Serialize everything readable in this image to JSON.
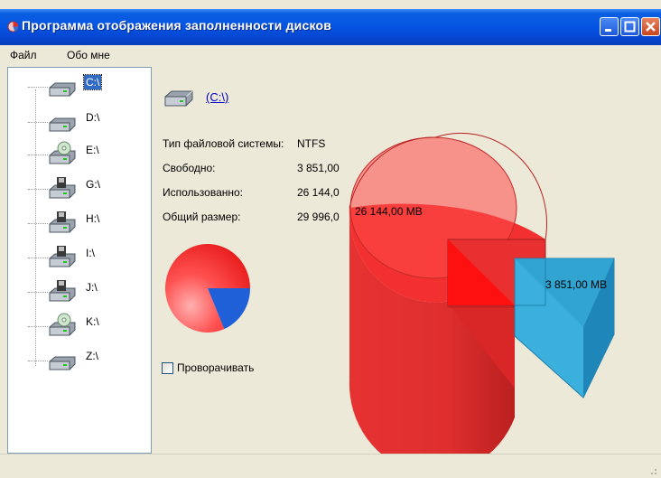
{
  "window": {
    "title": "Программа отображения заполненности дисков"
  },
  "menu": [
    {
      "label": "Файл"
    },
    {
      "label": "Обо мне"
    }
  ],
  "tree": {
    "items": [
      {
        "label": "C:\\",
        "icon": "hard-drive-icon",
        "selected": true
      },
      {
        "label": "D:\\",
        "icon": "hard-drive-icon"
      },
      {
        "label": "E:\\",
        "icon": "cd-drive-icon"
      },
      {
        "label": "G:\\",
        "icon": "removable-drive-icon"
      },
      {
        "label": "H:\\",
        "icon": "removable-drive-icon"
      },
      {
        "label": "I:\\",
        "icon": "removable-drive-icon"
      },
      {
        "label": "J:\\",
        "icon": "removable-drive-icon"
      },
      {
        "label": "K:\\",
        "icon": "cd-drive-icon"
      },
      {
        "label": "Z:\\",
        "icon": "hard-drive-icon"
      }
    ]
  },
  "details": {
    "drive_link": "(C:\\)",
    "fs_type_label": "Тип файловой системы:",
    "fs_type_value": "NTFS",
    "free_label": "Свободно:",
    "free_value": "3 851,00",
    "used_label": "Использованно:",
    "used_value": "26 144,0",
    "total_label": "Общий размер:",
    "total_value": "29 996,0",
    "rotate_label": "Проворачивать"
  },
  "chart_data": [
    {
      "type": "pie",
      "categories": [
        "Использованно",
        "Свободно"
      ],
      "values": [
        26144.0,
        3851.0
      ],
      "colors": [
        "#f03434",
        "#1f5fd8"
      ]
    },
    {
      "type": "pie",
      "categories": [
        "Использованно",
        "Свободно"
      ],
      "values": [
        26144.0,
        3851.0
      ],
      "data_labels": [
        "26 144,00 MB",
        "3 851,00 MB"
      ],
      "colors": [
        "#f23030",
        "#3bb0dc"
      ]
    }
  ]
}
